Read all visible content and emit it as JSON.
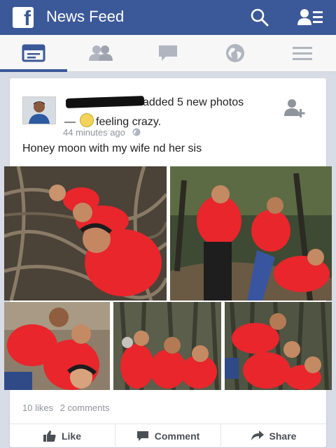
{
  "header": {
    "title": "News Feed",
    "logo_letter": "f"
  },
  "tabs": [
    {
      "icon": "news-feed-icon",
      "active": true
    },
    {
      "icon": "friends-icon",
      "active": false
    },
    {
      "icon": "messages-icon",
      "active": false
    },
    {
      "icon": "globe-icon",
      "active": false
    },
    {
      "icon": "menu-icon",
      "active": false
    }
  ],
  "post": {
    "headline": "added 5 new photos",
    "feeling_prefix": "—",
    "feeling": "feeling crazy.",
    "timestamp": "44 minutes ago",
    "caption": "Honey moon with my wife nd her sis",
    "likes": "10 likes",
    "comments": "2 comments"
  },
  "actions": {
    "like": "Like",
    "comment": "Comment",
    "share": "Share"
  },
  "colors": {
    "brand": "#3b5998",
    "shirt": "#e8262c"
  }
}
